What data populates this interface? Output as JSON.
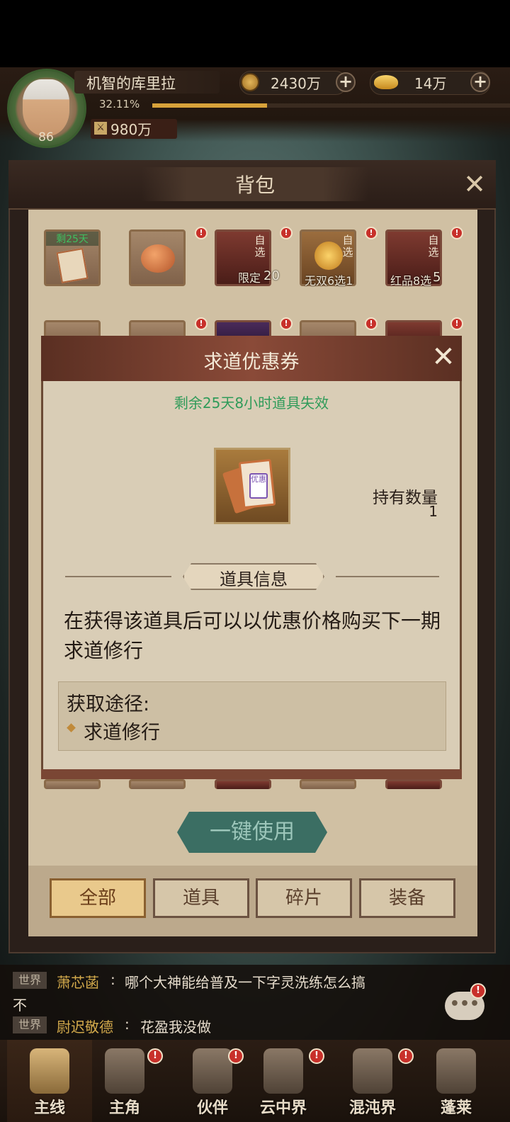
{
  "hud": {
    "player_name": "机智的库里拉",
    "level": "86",
    "exp_percent": "32.11%",
    "exp_fraction": 0.32,
    "power": "980万",
    "coins": "2430万",
    "ingots": "14万",
    "plus": "+"
  },
  "bag": {
    "title": "背包",
    "close": "✕",
    "row1": [
      {
        "top": "剩25天",
        "badge": ""
      },
      {
        "badge": "!"
      },
      {
        "zixuan": "自选",
        "caption": "限定",
        "count": "20",
        "badge": "!"
      },
      {
        "zixuan": "自选",
        "caption": "无双6选1",
        "badge": "!"
      },
      {
        "zixuan": "自选",
        "caption": "红品8选",
        "count": "5",
        "badge": "!"
      }
    ],
    "row2_badge": "!",
    "one_key_use": "一键使用",
    "tabs": [
      "全部",
      "道具",
      "碎片",
      "装备"
    ]
  },
  "modal": {
    "title": "求道优惠券",
    "close": "✕",
    "expire_text": "剩余25天8小时道具失效",
    "hold_label": "持有数量",
    "hold_value": "1",
    "coupon_mark": "优惠",
    "section_title": "道具信息",
    "description": "在获得该道具后可以以优惠价格购买下一期求道修行",
    "source_title": "获取途径:",
    "source_items": [
      "求道修行"
    ]
  },
  "chat": {
    "lines": [
      {
        "tag": "世界",
        "name": "萧芯菡",
        "sep": ":",
        "msg": "哪个大神能给普及一下字灵洗练怎么搞",
        "wrap": "不"
      },
      {
        "tag": "世界",
        "name": "尉迟敬德",
        "sep": ":",
        "msg": "花盈我没做"
      }
    ],
    "button": "•••",
    "badge": "!"
  },
  "nav": {
    "items": [
      {
        "label": "主线",
        "icon": "crossed-swords-icon"
      },
      {
        "label": "主角",
        "icon": "hero-portrait-icon"
      },
      {
        "label": "伙伴",
        "icon": "partner-helmet-icon"
      },
      {
        "label": "云中界",
        "icon": "pagoda-icon"
      },
      {
        "label": "混沌界",
        "icon": "chaos-gate-icon"
      },
      {
        "label": "蓬莱",
        "icon": "immortal-figure-icon"
      }
    ],
    "badge": "!"
  }
}
